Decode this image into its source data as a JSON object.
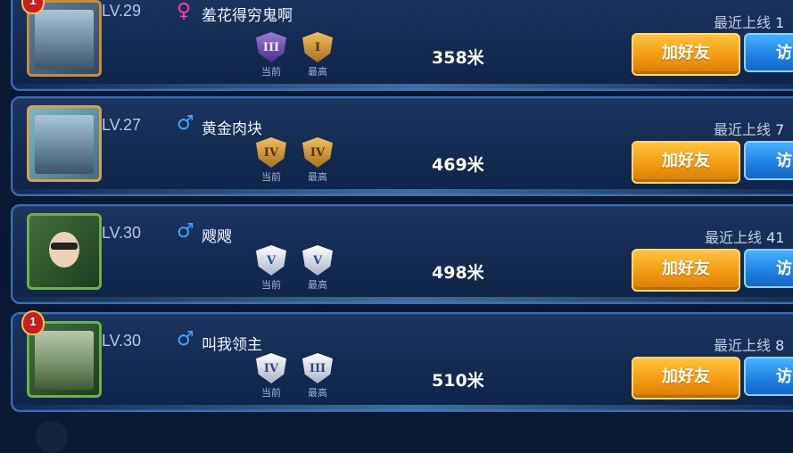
{
  "players": [
    {
      "level": "LV.29",
      "gender": "female",
      "gender_glyph": "♀",
      "name": "羞花得穷鬼啊",
      "badge": "1",
      "rank_current": "III",
      "rank_current_label": "当前",
      "rank_best": "I",
      "rank_best_label": "最高",
      "distance": "358米",
      "online_label": "最近上线",
      "online_trail": "1",
      "add_label": "加好友",
      "visit_label": "访"
    },
    {
      "level": "LV.27",
      "gender": "male",
      "gender_glyph": "♂",
      "name": "黄金肉块",
      "badge": "",
      "rank_current": "IV",
      "rank_current_label": "当前",
      "rank_best": "IV",
      "rank_best_label": "最高",
      "distance": "469米",
      "online_label": "最近上线",
      "online_trail": "7",
      "add_label": "加好友",
      "visit_label": "访"
    },
    {
      "level": "LV.30",
      "gender": "male",
      "gender_glyph": "♂",
      "name": "飕飕",
      "badge": "",
      "rank_current": "V",
      "rank_current_label": "当前",
      "rank_best": "V",
      "rank_best_label": "最高",
      "distance": "498米",
      "online_label": "最近上线",
      "online_trail": "41",
      "add_label": "加好友",
      "visit_label": "访"
    },
    {
      "level": "LV.30",
      "gender": "male",
      "gender_glyph": "♂",
      "name": "叫我领主",
      "badge": "1",
      "rank_current": "IV",
      "rank_current_label": "当前",
      "rank_best": "III",
      "rank_best_label": "最高",
      "distance": "510米",
      "online_label": "最近上线",
      "online_trail": "8",
      "add_label": "加好友",
      "visit_label": "访"
    }
  ]
}
